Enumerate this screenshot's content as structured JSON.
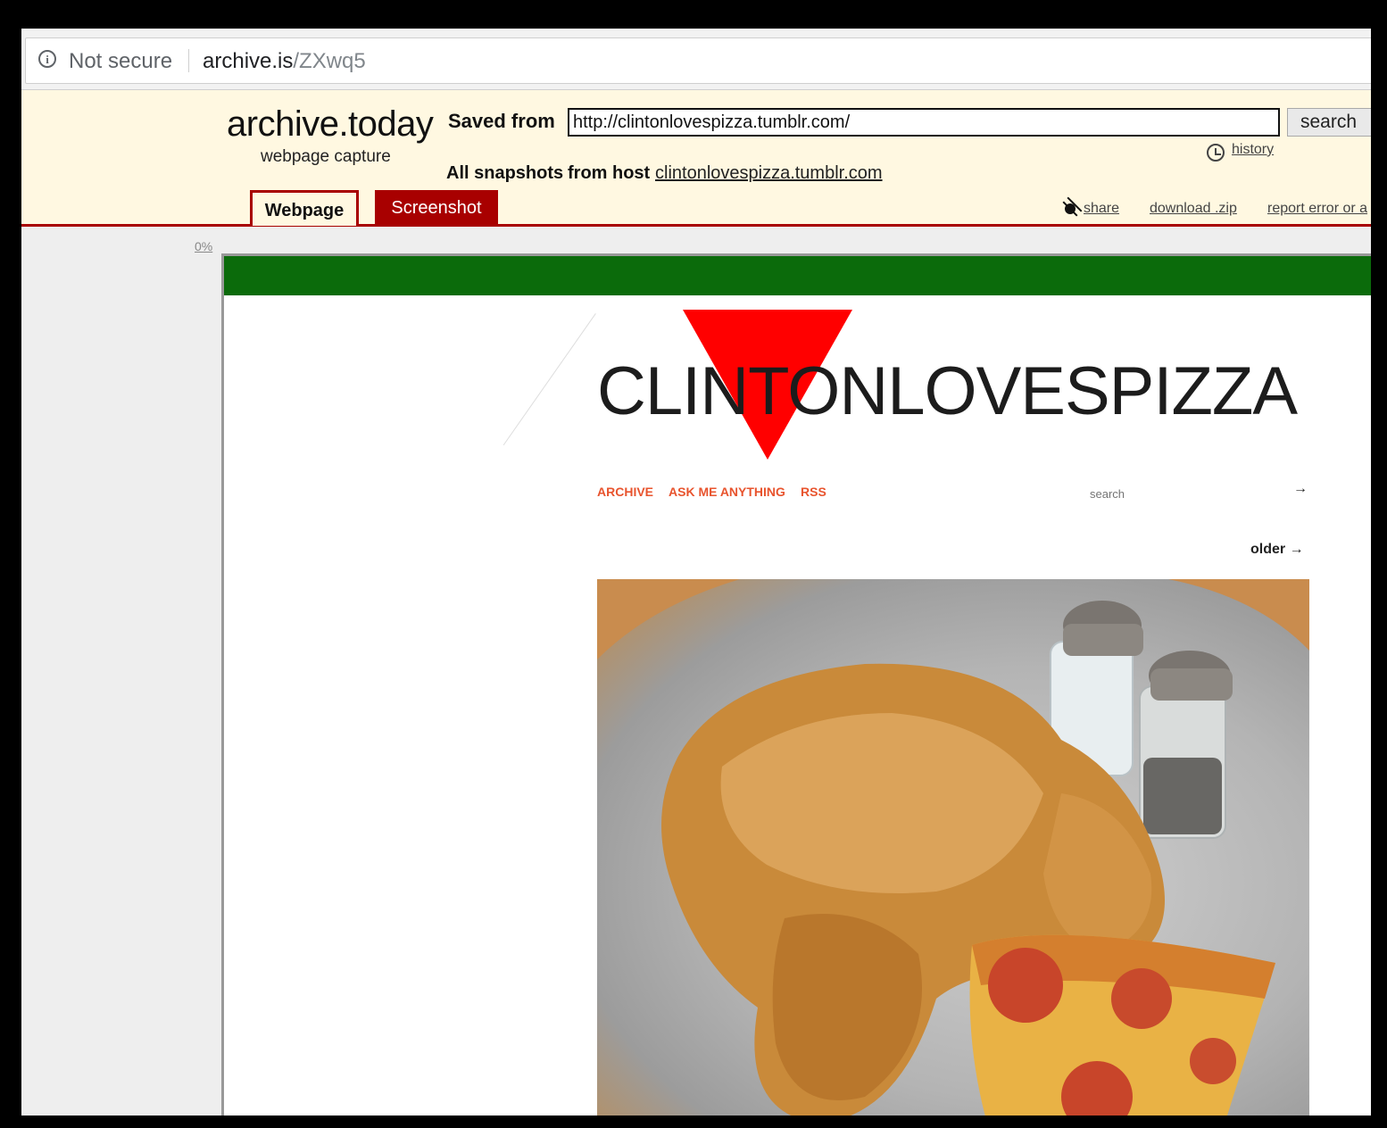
{
  "browser": {
    "security_label": "Not secure",
    "url_host": "archive.is",
    "url_path": "/ZXwq5"
  },
  "archive": {
    "brand": "archive.today",
    "brand_sub": "webpage capture",
    "saved_from_label": "Saved from",
    "saved_url": "http://clintonlovespizza.tumblr.com/",
    "search_label": "search",
    "history_label": "history",
    "all_snapshots_label": "All snapshots",
    "from_host_label": "from host",
    "host": "clintonlovespizza.tumblr.com",
    "tabs": [
      {
        "label": "Webpage",
        "active": true
      },
      {
        "label": "Screenshot",
        "active": false
      }
    ],
    "share_label": "share",
    "download_label": "download .zip",
    "report_label": "report error or a",
    "progress_label": "0%"
  },
  "blog": {
    "title": "CLINTONLOVESPIZZA",
    "nav": [
      "ARCHIVE",
      "ASK ME ANYTHING",
      "RSS"
    ],
    "search_placeholder": "search",
    "search_go": "→",
    "older_label": "older →"
  },
  "colors": {
    "archive_red": "#a80000",
    "header_bg": "#fff8e1",
    "green_bar": "#0b6b0b",
    "triangle": "#ff0000",
    "nav_orange": "#e8542e"
  }
}
